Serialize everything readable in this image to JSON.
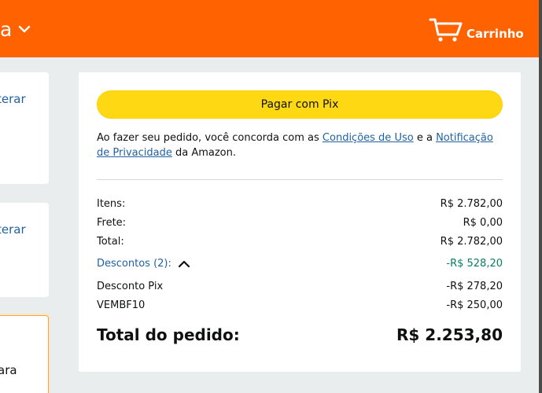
{
  "header": {
    "partial_text": "a",
    "cart_label": "Carrinho"
  },
  "left_cards": {
    "change_link_1": "terar",
    "change_link_2": "terar",
    "partial_text_3": "ara"
  },
  "order": {
    "pay_button": "Pagar com Pix",
    "terms_prefix": "Ao fazer seu pedido, você concorda com as ",
    "terms_link_1": "Condições de Uso",
    "terms_middle": " e a ",
    "terms_link_2": "Notificação de Privacidade",
    "terms_suffix": " da Amazon.",
    "items_label": "Itens:",
    "items_value": "R$ 2.782,00",
    "shipping_label": "Frete:",
    "shipping_value": "R$ 0,00",
    "subtotal_label": "Total:",
    "subtotal_value": "R$ 2.782,00",
    "discounts_label": "Descontos (2):",
    "discounts_value": "-R$ 528,20",
    "discount_1_label": "Desconto Pix",
    "discount_1_value": "-R$ 278,20",
    "discount_2_label": "VEMBF10",
    "discount_2_value": "-R$ 250,00",
    "order_total_label": "Total do pedido:",
    "order_total_value": "R$ 2.253,80"
  },
  "colors": {
    "header_bg": "#ff6200",
    "button_yellow": "#ffd814",
    "link_blue": "#2162a1",
    "discount_green": "#067d62"
  }
}
